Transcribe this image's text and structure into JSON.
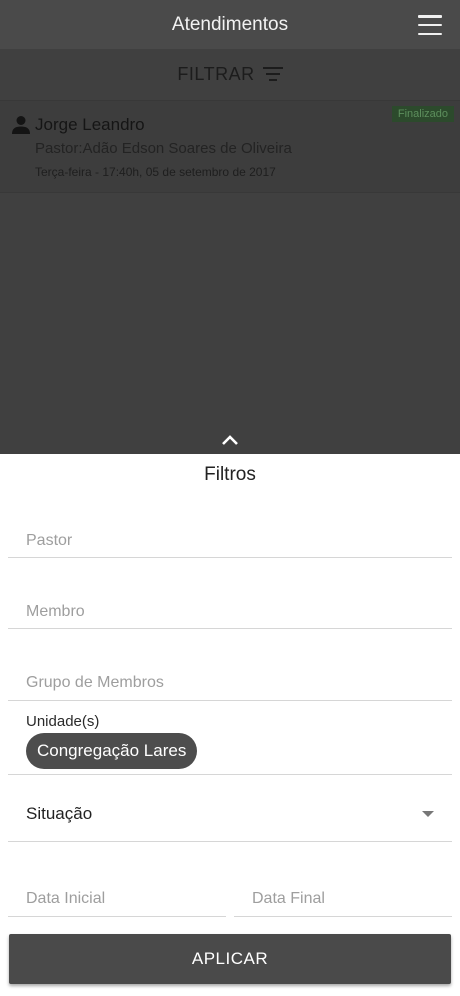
{
  "header": {
    "title": "Atendimentos",
    "menu_icon": "hamburger-menu-icon"
  },
  "filter_bar": {
    "label": "FILTRAR",
    "icon": "filter-list-icon"
  },
  "appointments": [
    {
      "name": "Jorge Leandro",
      "pastor": "Pastor:Adão Edson Soares de Oliveira",
      "date": "Terça-feira - 17:40h, 05 de setembro de 2017",
      "status": "Finalizado",
      "icon": "person-icon"
    }
  ],
  "sheet": {
    "toggle_icon": "chevron-up-icon",
    "title": "Filtros",
    "fields": {
      "pastor_placeholder": "Pastor",
      "membro_placeholder": "Membro",
      "grupo_placeholder": "Grupo de Membros",
      "unidade_label": "Unidade(s)",
      "unidade_chip": "Congregação Lares",
      "situacao_label": "Situação",
      "data_inicial_placeholder": "Data Inicial",
      "data_final_placeholder": "Data Final"
    },
    "apply_label": "APLICAR"
  },
  "colors": {
    "header_bg": "#4a4a4a",
    "overlay_bg": "#404040",
    "badge_bg": "#2c4a2c",
    "chip_bg": "#4d4d4d",
    "button_bg": "#4a4a4a"
  }
}
